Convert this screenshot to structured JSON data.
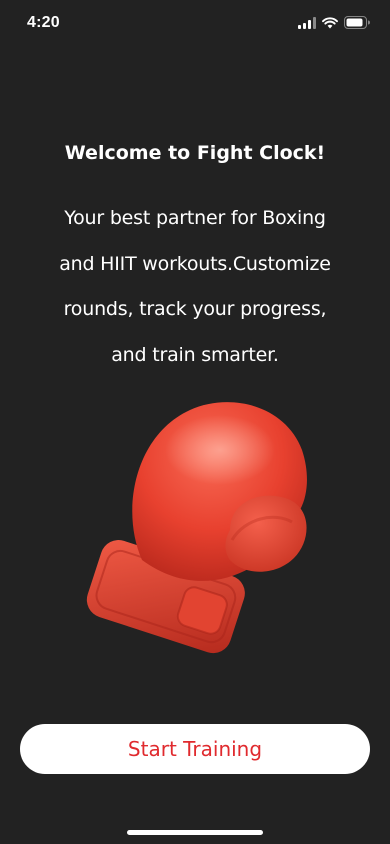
{
  "status_bar": {
    "time": "4:20",
    "icons": [
      "signal-icon",
      "wifi-icon",
      "battery-icon"
    ]
  },
  "welcome": {
    "title": "Welcome to Fight Clock!",
    "description_lines": [
      "Your best partner for Boxing",
      "and HIIT workouts.Customize",
      "rounds, track your progress,",
      "and train smarter."
    ]
  },
  "illustration": {
    "icon": "boxing-glove-icon",
    "color": "#e8412f"
  },
  "cta": {
    "label": "Start Training",
    "text_color": "#e02a2e"
  },
  "theme": {
    "background": "#222222",
    "accent": "#e8412f"
  }
}
